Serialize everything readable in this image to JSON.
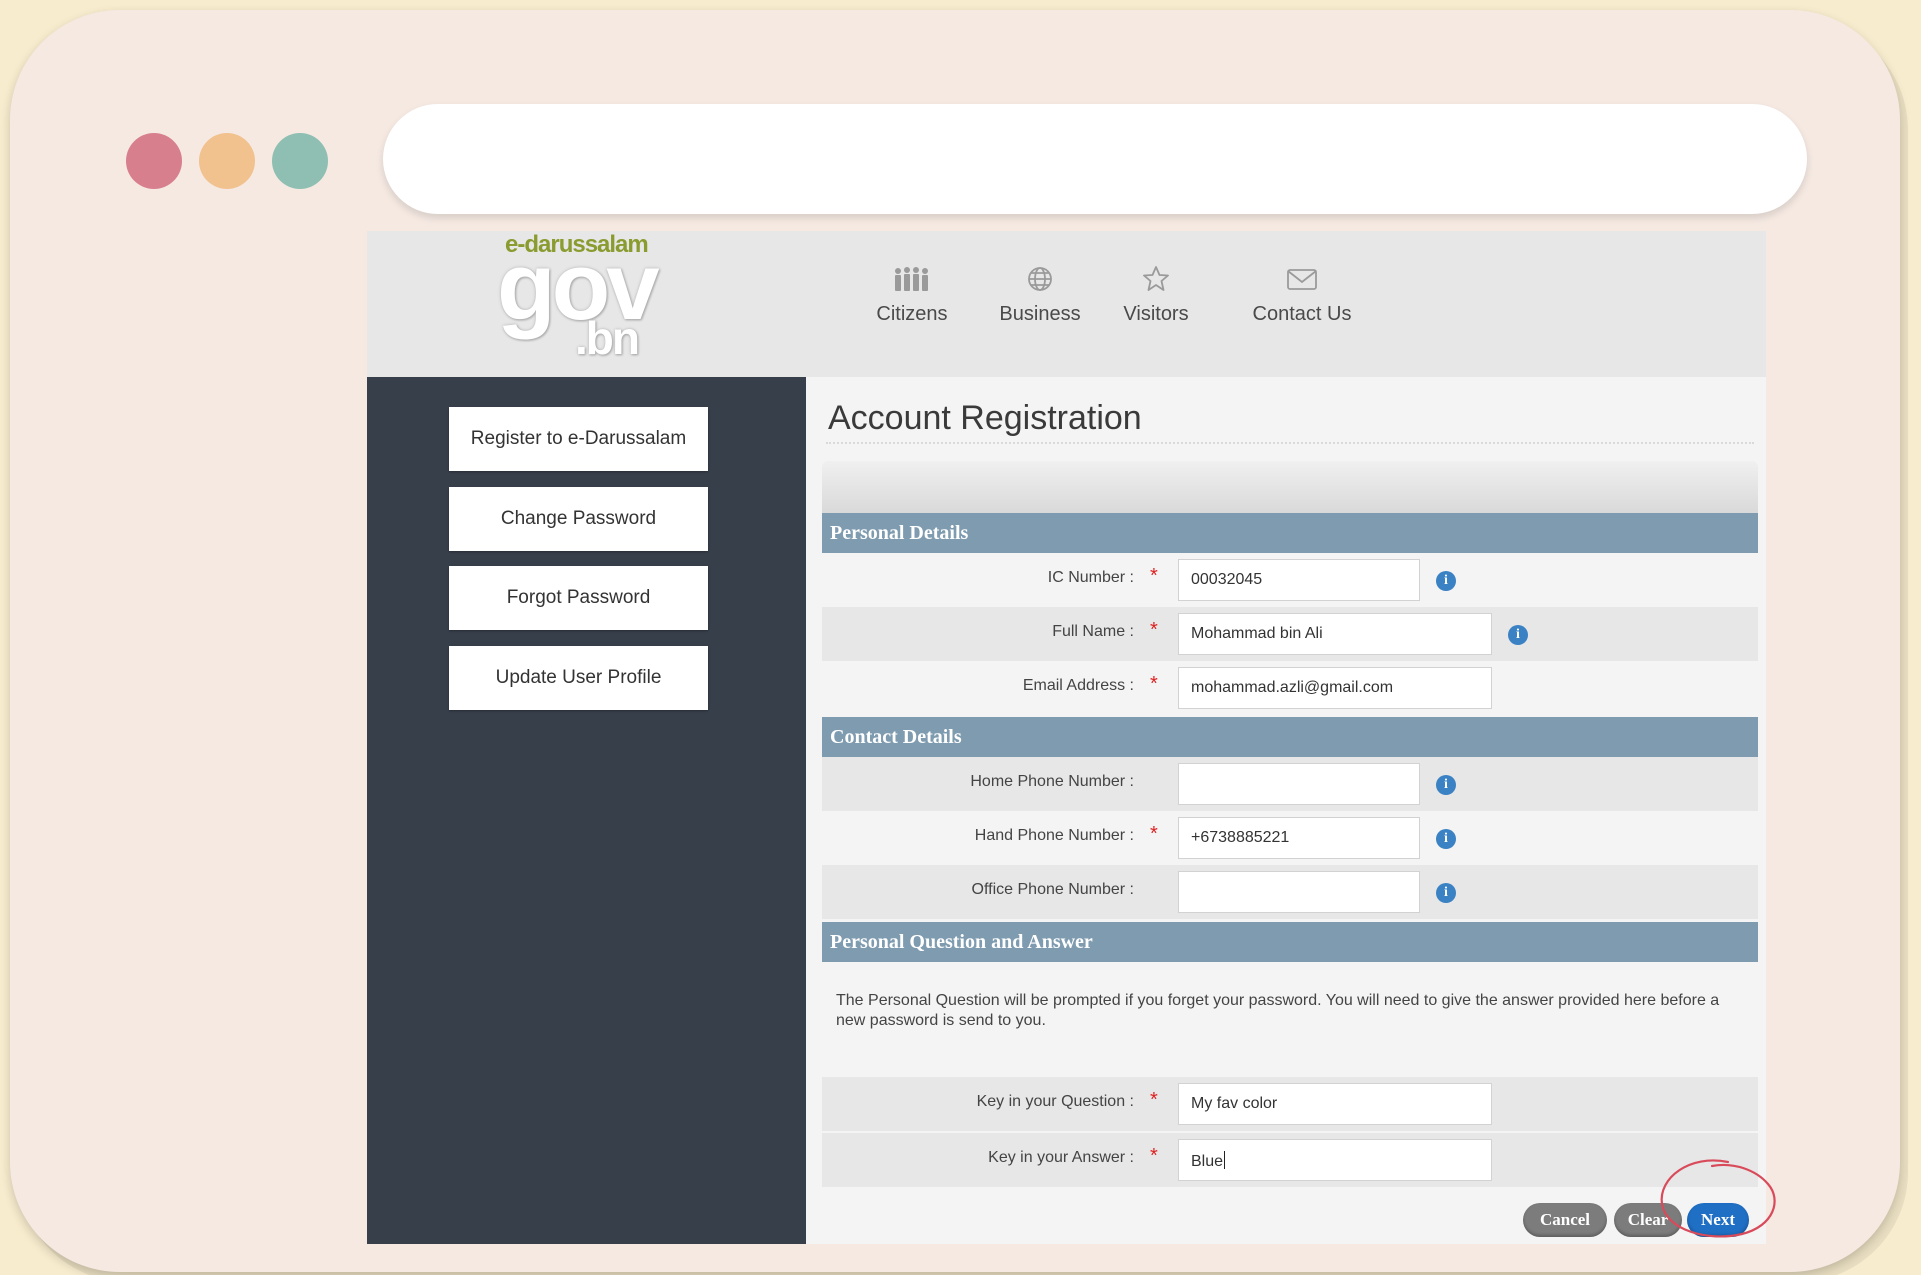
{
  "nav": {
    "items": [
      {
        "label": "Citizens",
        "icon": "people-icon"
      },
      {
        "label": "Business",
        "icon": "globe-icon"
      },
      {
        "label": "Visitors",
        "icon": "star-icon"
      },
      {
        "label": "Contact Us",
        "icon": "envelope-icon"
      }
    ]
  },
  "logo": {
    "top": "e-darussalam",
    "main": "gov",
    "sub": ".bn"
  },
  "sidebar": {
    "items": [
      {
        "label": "Register to e-Darussalam"
      },
      {
        "label": "Change Password"
      },
      {
        "label": "Forgot Password"
      },
      {
        "label": "Update User Profile"
      }
    ]
  },
  "page": {
    "title": "Account Registration"
  },
  "sections": {
    "personal": "Personal Details",
    "contact": "Contact Details",
    "question": "Personal Question and Answer"
  },
  "fields": {
    "ic": {
      "label": "IC Number :",
      "value": "00032045"
    },
    "full_name": {
      "label": "Full Name :",
      "value": "Mohammad bin Ali"
    },
    "email": {
      "label": "Email Address :",
      "value": "mohammad.azli@gmail.com"
    },
    "home_phone": {
      "label": "Home Phone Number :",
      "value": ""
    },
    "hand_phone": {
      "label": "Hand Phone Number :",
      "value": "+6738885221"
    },
    "office_phone": {
      "label": "Office Phone Number :",
      "value": ""
    },
    "question": {
      "label": "Key in your Question :",
      "value": "My fav color"
    },
    "answer": {
      "label": "Key in your Answer :",
      "value": "Blue"
    }
  },
  "required_marker": "*",
  "info_glyph": "i",
  "question_note": "The Personal Question will be prompted if you forget your password. You will need to give the answer provided here before a new password is send to you.",
  "buttons": {
    "cancel": "Cancel",
    "clear": "Clear",
    "next": "Next"
  },
  "colors": {
    "section_header": "#7e9bb0",
    "sidebar": "#373f4b",
    "next_button": "#1f6fc5",
    "highlight_circle": "#d94a5a"
  }
}
